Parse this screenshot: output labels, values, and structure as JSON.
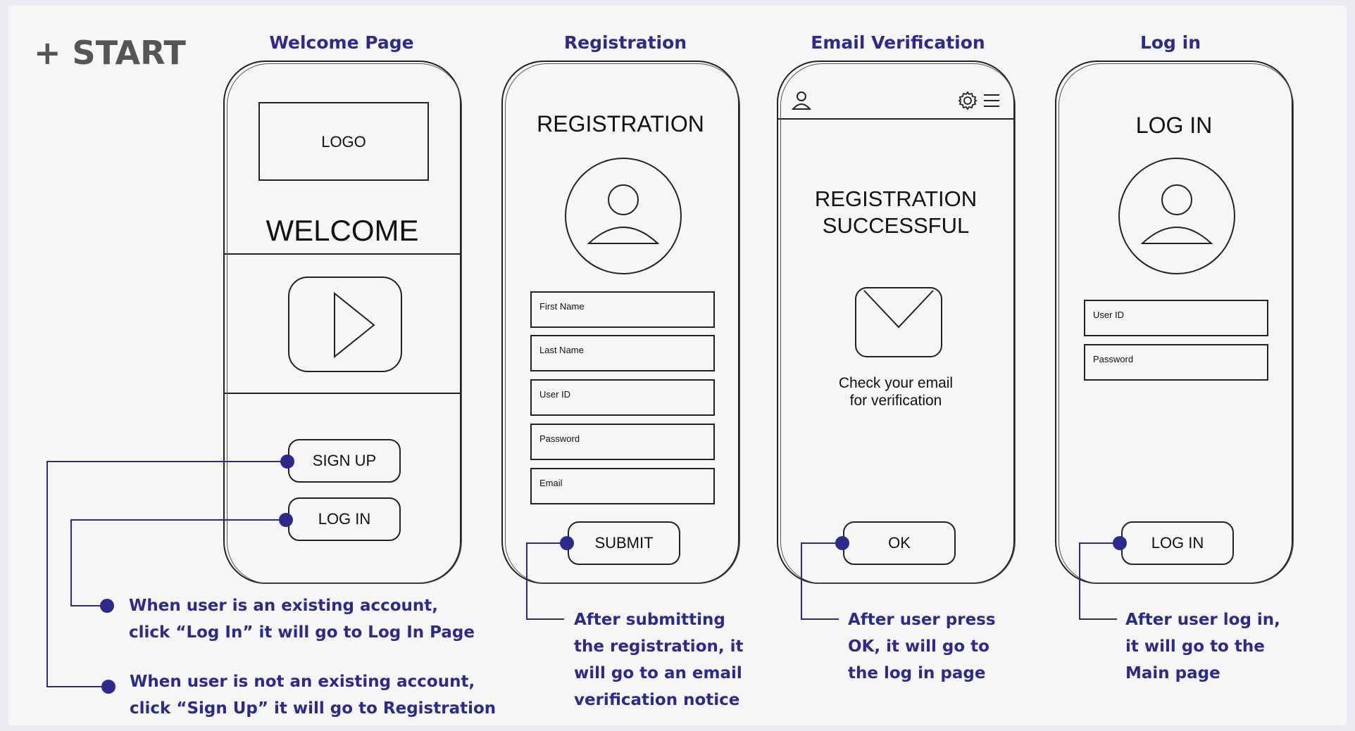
{
  "start_label": "+ START",
  "colors": {
    "accent": "#2d2a8c",
    "ink": "#222222",
    "background": "#f6f6f6"
  },
  "screens": {
    "welcome": {
      "title": "Welcome Page",
      "logo": "LOGO",
      "heading": "WELCOME",
      "video_icon": "play-icon",
      "signup_button": "SIGN UP",
      "login_button": "LOG IN"
    },
    "registration": {
      "title": "Registration",
      "heading": "REGISTRATION",
      "avatar_icon": "user-avatar-icon",
      "fields": [
        "First Name",
        "Last Name",
        "User ID",
        "Password",
        "Email"
      ],
      "submit_button": "SUBMIT"
    },
    "email_verification": {
      "title": "Email Verification",
      "header_icons": [
        "user-icon",
        "gear-icon",
        "menu-icon"
      ],
      "heading_line1": "REGISTRATION",
      "heading_line2": "SUCCESSFUL",
      "mail_icon": "envelope-icon",
      "message_line1": "Check your email",
      "message_line2": "for verification",
      "ok_button": "OK"
    },
    "login": {
      "title": "Log in",
      "heading": "LOG IN",
      "avatar_icon": "user-avatar-icon",
      "fields": [
        "User ID",
        "Password"
      ],
      "login_button": "LOG IN"
    }
  },
  "notes": {
    "login_note": [
      "When user is an existing account,",
      "click “Log In” it will go to Log In Page"
    ],
    "signup_note": [
      "When user is not an existing account,",
      "click “Sign Up” it will go to Registration"
    ],
    "submit_note": [
      "After submitting",
      "the registration, it",
      "will go to an email",
      "verification notice"
    ],
    "ok_note": [
      "After user press",
      "OK, it will go to",
      "the log in page"
    ],
    "login_done_note": [
      "After user log in,",
      "it will go to the",
      "Main page"
    ]
  }
}
